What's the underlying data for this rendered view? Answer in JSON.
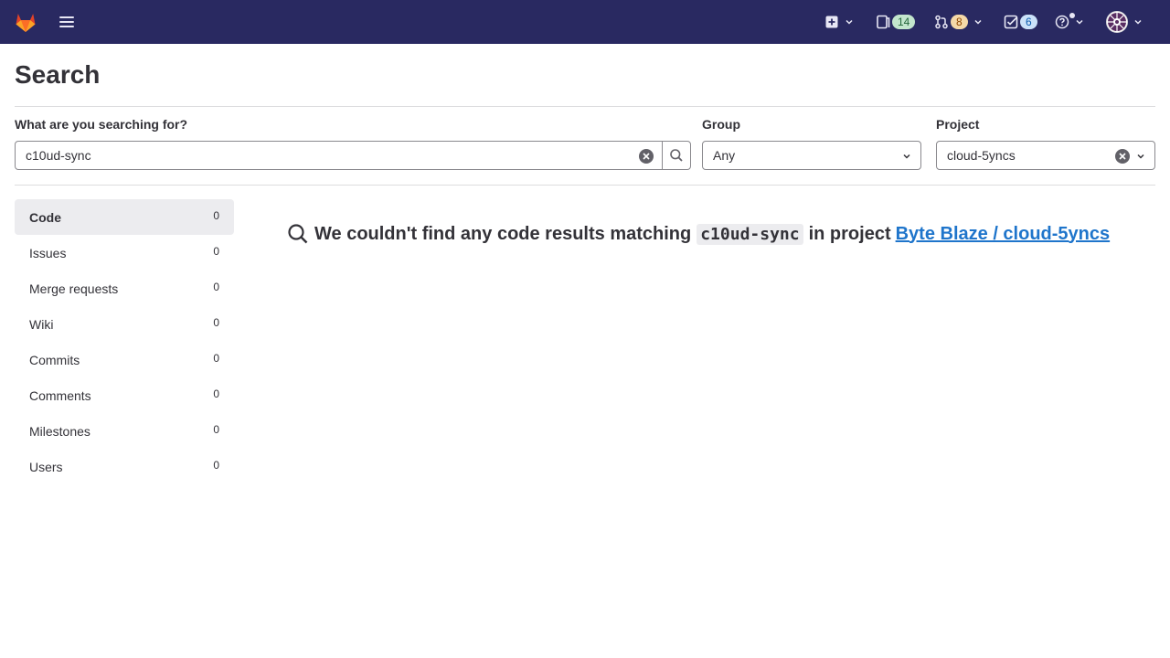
{
  "navbar": {
    "issues_count": "14",
    "merge_requests_count": "8",
    "todos_count": "6"
  },
  "page": {
    "title": "Search"
  },
  "search": {
    "label": "What are you searching for?",
    "value": "c10ud-sync"
  },
  "group_filter": {
    "label": "Group",
    "value": "Any"
  },
  "project_filter": {
    "label": "Project",
    "value": "cloud-5yncs"
  },
  "sidebar": {
    "items": [
      {
        "label": "Code",
        "count": "0"
      },
      {
        "label": "Issues",
        "count": "0"
      },
      {
        "label": "Merge requests",
        "count": "0"
      },
      {
        "label": "Wiki",
        "count": "0"
      },
      {
        "label": "Commits",
        "count": "0"
      },
      {
        "label": "Comments",
        "count": "0"
      },
      {
        "label": "Milestones",
        "count": "0"
      },
      {
        "label": "Users",
        "count": "0"
      }
    ]
  },
  "results": {
    "prefix": "We couldn't find any code results matching",
    "term": "c10ud-sync",
    "middle": "in project",
    "project_link": "Byte Blaze / cloud-5yncs"
  }
}
